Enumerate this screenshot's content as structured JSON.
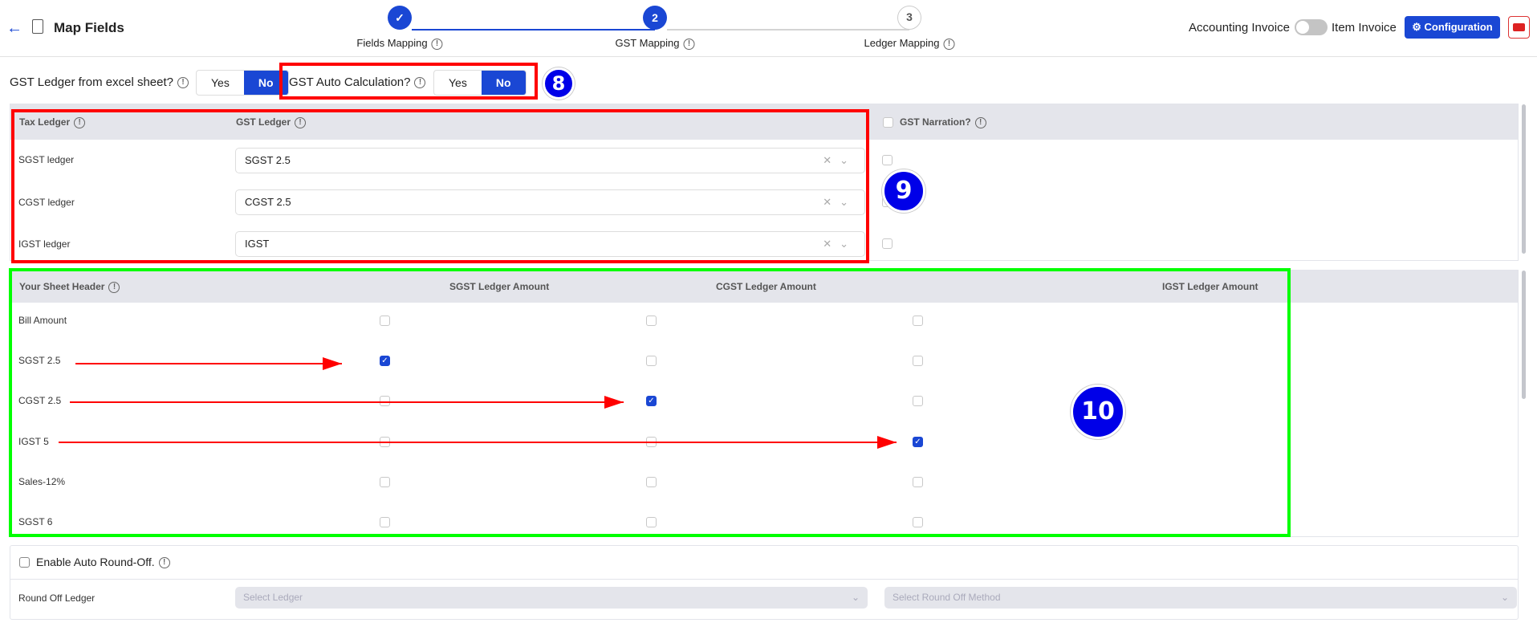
{
  "header": {
    "title": "Map Fields",
    "back_icon": "arrow-left-icon",
    "doc_icon": "document-edit-icon",
    "steps": [
      {
        "number": "1",
        "label": "Fields Mapping",
        "state": "complete"
      },
      {
        "number": "2",
        "label": "GST Mapping",
        "state": "active"
      },
      {
        "number": "3",
        "label": "Ledger Mapping",
        "state": "pending"
      }
    ],
    "toggle_left": "Accounting Invoice",
    "toggle_right": "Item Invoice",
    "toggle_on": false,
    "config_label": "Configuration",
    "youtube_icon": "youtube-icon"
  },
  "options": {
    "gst_ledger_excel": {
      "label": "GST Ledger from excel sheet?",
      "yes": "Yes",
      "no": "No",
      "selected": "No"
    },
    "gst_auto_calc": {
      "label": "GST Auto Calculation?",
      "yes": "Yes",
      "no": "No",
      "selected": "No"
    }
  },
  "tax_table": {
    "col_tax": "Tax Ledger",
    "col_gst": "GST Ledger",
    "col_narration": "GST Narration?",
    "rows": [
      {
        "tax": "SGST ledger",
        "gst": "SGST 2.5"
      },
      {
        "tax": "CGST ledger",
        "gst": "CGST 2.5"
      },
      {
        "tax": "IGST ledger",
        "gst": "IGST"
      }
    ]
  },
  "sheet_table": {
    "col_header": "Your Sheet Header",
    "col_sgst": "SGST Ledger Amount",
    "col_cgst": "CGST Ledger Amount",
    "col_igst": "IGST Ledger Amount",
    "rows": [
      {
        "name": "Bill Amount",
        "checks": [
          false,
          false,
          false
        ]
      },
      {
        "name": "SGST 2.5",
        "checks": [
          true,
          false,
          false
        ]
      },
      {
        "name": "CGST 2.5",
        "checks": [
          false,
          true,
          false
        ]
      },
      {
        "name": "IGST 5",
        "checks": [
          false,
          false,
          true
        ]
      },
      {
        "name": "Sales-12%",
        "checks": [
          false,
          false,
          false
        ]
      },
      {
        "name": "SGST 6",
        "checks": [
          false,
          false,
          false
        ]
      }
    ]
  },
  "round_off": {
    "enable_label": "Enable Auto Round-Off.",
    "ledger_label": "Round Off Ledger",
    "ledger_placeholder": "Select Ledger",
    "method_placeholder": "Select Round Off Method"
  },
  "annotations": {
    "badges": [
      "8",
      "9",
      "10"
    ],
    "colors": {
      "red": "#ff0000",
      "green": "#00ff00",
      "badge": "#0000e8"
    }
  },
  "colors": {
    "primary": "#1a47d4",
    "header_bg": "#e4e5eb"
  }
}
